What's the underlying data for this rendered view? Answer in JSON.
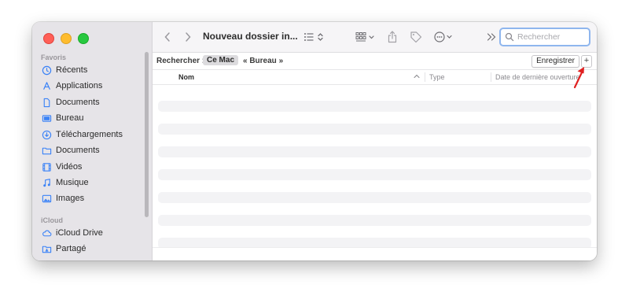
{
  "window": {
    "title": "Nouveau dossier in..."
  },
  "sidebar": {
    "favorites_label": "Favoris",
    "favorites": [
      {
        "label": "Récents",
        "icon": "clock-icon"
      },
      {
        "label": "Applications",
        "icon": "applications-icon"
      },
      {
        "label": "Documents",
        "icon": "document-icon"
      },
      {
        "label": "Bureau",
        "icon": "desktop-icon"
      },
      {
        "label": "Téléchargements",
        "icon": "download-icon"
      },
      {
        "label": "Documents",
        "icon": "folder-icon"
      },
      {
        "label": "Vidéos",
        "icon": "film-icon"
      },
      {
        "label": "Musique",
        "icon": "music-icon"
      },
      {
        "label": "Images",
        "icon": "photo-icon"
      }
    ],
    "icloud_label": "iCloud",
    "icloud": [
      {
        "label": "iCloud Drive",
        "icon": "cloud-icon"
      },
      {
        "label": "Partagé",
        "icon": "shared-folder-icon"
      }
    ]
  },
  "search": {
    "placeholder": "Rechercher",
    "value": ""
  },
  "scope": {
    "label": "Rechercher :",
    "selected": "Ce Mac",
    "other": "« Bureau »",
    "save_label": "Enregistrer",
    "add_label": "+"
  },
  "columns": {
    "name": "Nom",
    "type": "Type",
    "date": "Date de dernière ouverture"
  },
  "colors": {
    "accent": "#8fb6ee",
    "annotation_arrow": "#e02020",
    "sidebar_icon": "#3a82f7"
  }
}
